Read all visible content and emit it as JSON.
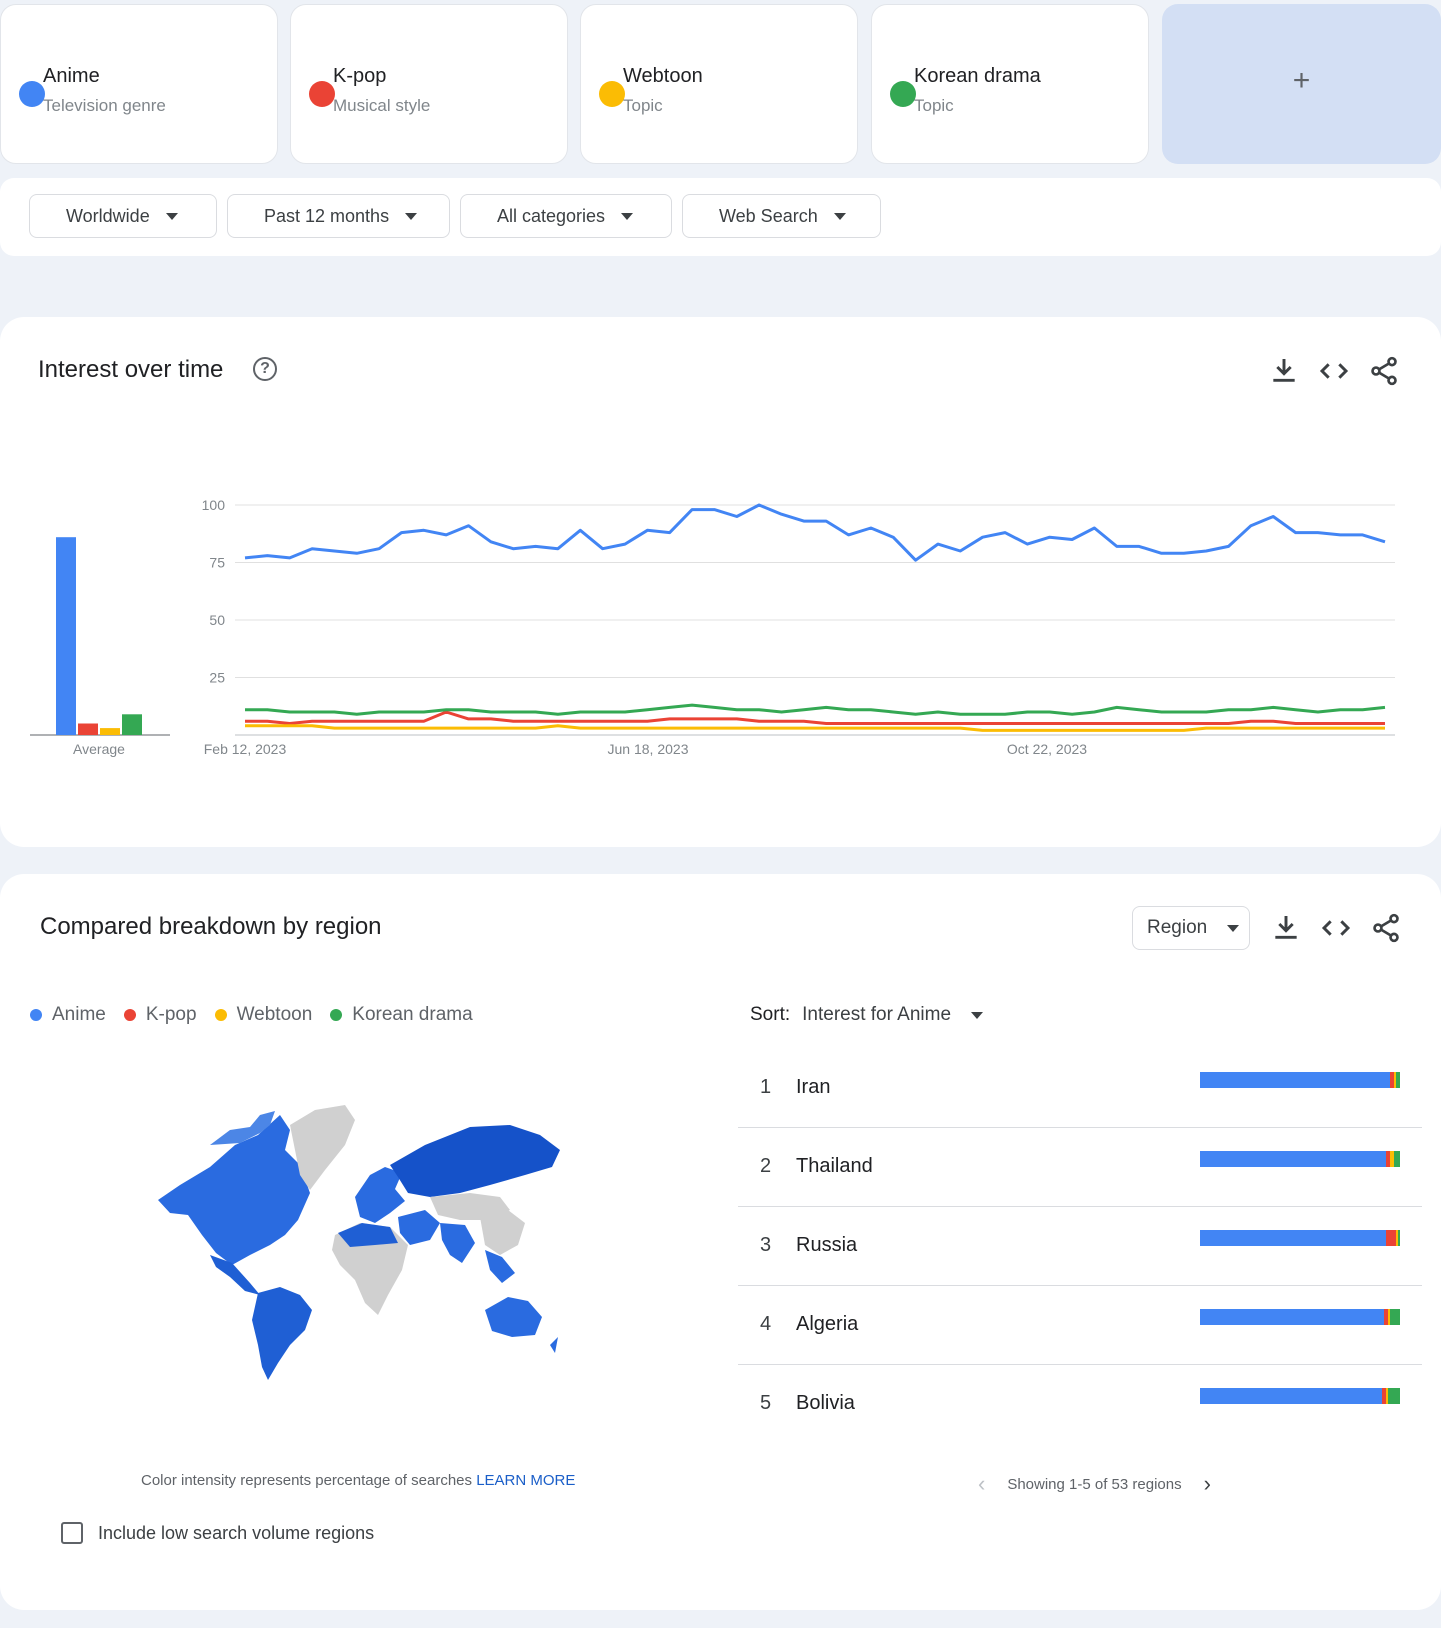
{
  "terms": [
    {
      "name": "Anime",
      "type": "Television genre",
      "color": "#4285f4"
    },
    {
      "name": "K-pop",
      "type": "Musical style",
      "color": "#ea4335"
    },
    {
      "name": "Webtoon",
      "type": "Topic",
      "color": "#fbbc04"
    },
    {
      "name": "Korean drama",
      "type": "Topic",
      "color": "#34a853"
    }
  ],
  "add_label": "+",
  "filters": {
    "location": "Worldwide",
    "time": "Past 12 months",
    "category": "All categories",
    "search_type": "Web Search"
  },
  "interest": {
    "title": "Interest over time",
    "help_glyph": "?",
    "average_label": "Average"
  },
  "chart_data": {
    "type": "line",
    "x_tick_labels": [
      "Feb 12, 2023",
      "Jun 18, 2023",
      "Oct 22, 2023"
    ],
    "y_ticks": [
      25,
      50,
      75,
      100
    ],
    "ylim": [
      0,
      100
    ],
    "grid": true,
    "averages": {
      "Anime": 86,
      "K-pop": 5,
      "Webtoon": 3,
      "Korean drama": 9
    },
    "series": [
      {
        "name": "Anime",
        "color": "#4285f4",
        "values": [
          77,
          78,
          77,
          81,
          80,
          79,
          81,
          88,
          89,
          87,
          91,
          84,
          81,
          82,
          81,
          89,
          81,
          83,
          89,
          88,
          98,
          98,
          95,
          100,
          96,
          93,
          93,
          87,
          90,
          86,
          76,
          83,
          80,
          86,
          88,
          83,
          86,
          85,
          90,
          82,
          82,
          79,
          79,
          80,
          82,
          91,
          95,
          88,
          88,
          87,
          87,
          84
        ]
      },
      {
        "name": "K-pop",
        "color": "#ea4335",
        "values": [
          6,
          6,
          5,
          6,
          6,
          6,
          6,
          6,
          6,
          10,
          7,
          7,
          6,
          6,
          6,
          6,
          6,
          6,
          6,
          7,
          7,
          7,
          7,
          6,
          6,
          6,
          5,
          5,
          5,
          5,
          5,
          5,
          5,
          5,
          5,
          5,
          5,
          5,
          5,
          5,
          5,
          5,
          5,
          5,
          5,
          6,
          6,
          5,
          5,
          5,
          5,
          5
        ]
      },
      {
        "name": "Webtoon",
        "color": "#fbbc04",
        "values": [
          4,
          4,
          4,
          4,
          3,
          3,
          3,
          3,
          3,
          3,
          3,
          3,
          3,
          3,
          4,
          3,
          3,
          3,
          3,
          3,
          3,
          3,
          3,
          3,
          3,
          3,
          3,
          3,
          3,
          3,
          3,
          3,
          3,
          2,
          2,
          2,
          2,
          2,
          2,
          2,
          2,
          2,
          2,
          3,
          3,
          3,
          3,
          3,
          3,
          3,
          3,
          3
        ]
      },
      {
        "name": "Korean drama",
        "color": "#34a853",
        "values": [
          11,
          11,
          10,
          10,
          10,
          9,
          10,
          10,
          10,
          11,
          11,
          10,
          10,
          10,
          9,
          10,
          10,
          10,
          11,
          12,
          13,
          12,
          11,
          11,
          10,
          11,
          12,
          11,
          11,
          10,
          9,
          10,
          9,
          9,
          9,
          10,
          10,
          9,
          10,
          12,
          11,
          10,
          10,
          10,
          11,
          11,
          12,
          11,
          10,
          11,
          11,
          12
        ]
      }
    ]
  },
  "region": {
    "title": "Compared breakdown by region",
    "select_label": "Region",
    "sort_label": "Sort:",
    "sort_value": "Interest for Anime",
    "legend": [
      "Anime",
      "K-pop",
      "Webtoon",
      "Korean drama"
    ],
    "rows": [
      {
        "rank": "1",
        "name": "Iran",
        "shares": [
          0.95,
          0.02,
          0.01,
          0.02
        ]
      },
      {
        "rank": "2",
        "name": "Thailand",
        "shares": [
          0.93,
          0.02,
          0.02,
          0.03
        ]
      },
      {
        "rank": "3",
        "name": "Russia",
        "shares": [
          0.93,
          0.05,
          0.01,
          0.01
        ]
      },
      {
        "rank": "4",
        "name": "Algeria",
        "shares": [
          0.92,
          0.02,
          0.01,
          0.05
        ]
      },
      {
        "rank": "5",
        "name": "Bolivia",
        "shares": [
          0.91,
          0.02,
          0.01,
          0.06
        ]
      }
    ],
    "caption": "Color intensity represents percentage of searches",
    "learn_more": "LEARN MORE",
    "pager_text": "Showing 1-5 of 53 regions",
    "checkbox_label": "Include low search volume regions"
  }
}
